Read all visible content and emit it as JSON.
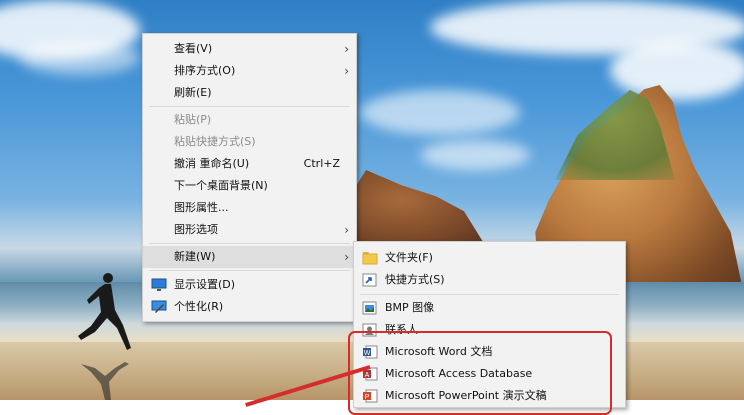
{
  "context_menu": {
    "items": [
      {
        "label": "查看(V)",
        "submenu": true
      },
      {
        "label": "排序方式(O)",
        "submenu": true
      },
      {
        "label": "刷新(E)"
      },
      {
        "label": "粘贴(P)",
        "disabled": true
      },
      {
        "label": "粘贴快捷方式(S)",
        "disabled": true
      },
      {
        "label": "撤消 重命名(U)",
        "shortcut": "Ctrl+Z"
      },
      {
        "label": "下一个桌面背景(N)"
      },
      {
        "label": "图形属性..."
      },
      {
        "label": "图形选项",
        "submenu": true
      },
      {
        "label": "新建(W)",
        "submenu": true,
        "highlighted": true
      },
      {
        "label": "显示设置(D)",
        "icon": "display-settings-icon"
      },
      {
        "label": "个性化(R)",
        "icon": "personalize-icon"
      }
    ]
  },
  "new_submenu": {
    "items": [
      {
        "label": "文件夹(F)",
        "icon": "folder-icon"
      },
      {
        "label": "快捷方式(S)",
        "icon": "shortcut-icon"
      },
      {
        "label": "BMP 图像",
        "icon": "bmp-image-icon"
      },
      {
        "label": "联系人",
        "icon": "contact-icon"
      },
      {
        "label": "Microsoft Word 文档",
        "icon": "word-doc-icon"
      },
      {
        "label": "Microsoft Access Database",
        "icon": "access-db-icon"
      },
      {
        "label": "Microsoft PowerPoint 演示文稿",
        "icon": "powerpoint-icon"
      }
    ]
  },
  "colors": {
    "menu_bg": "#f2f2f2",
    "highlight": "#dedede",
    "annotation_red": "#d62c2c",
    "folder_yellow": "#f3c84b"
  }
}
